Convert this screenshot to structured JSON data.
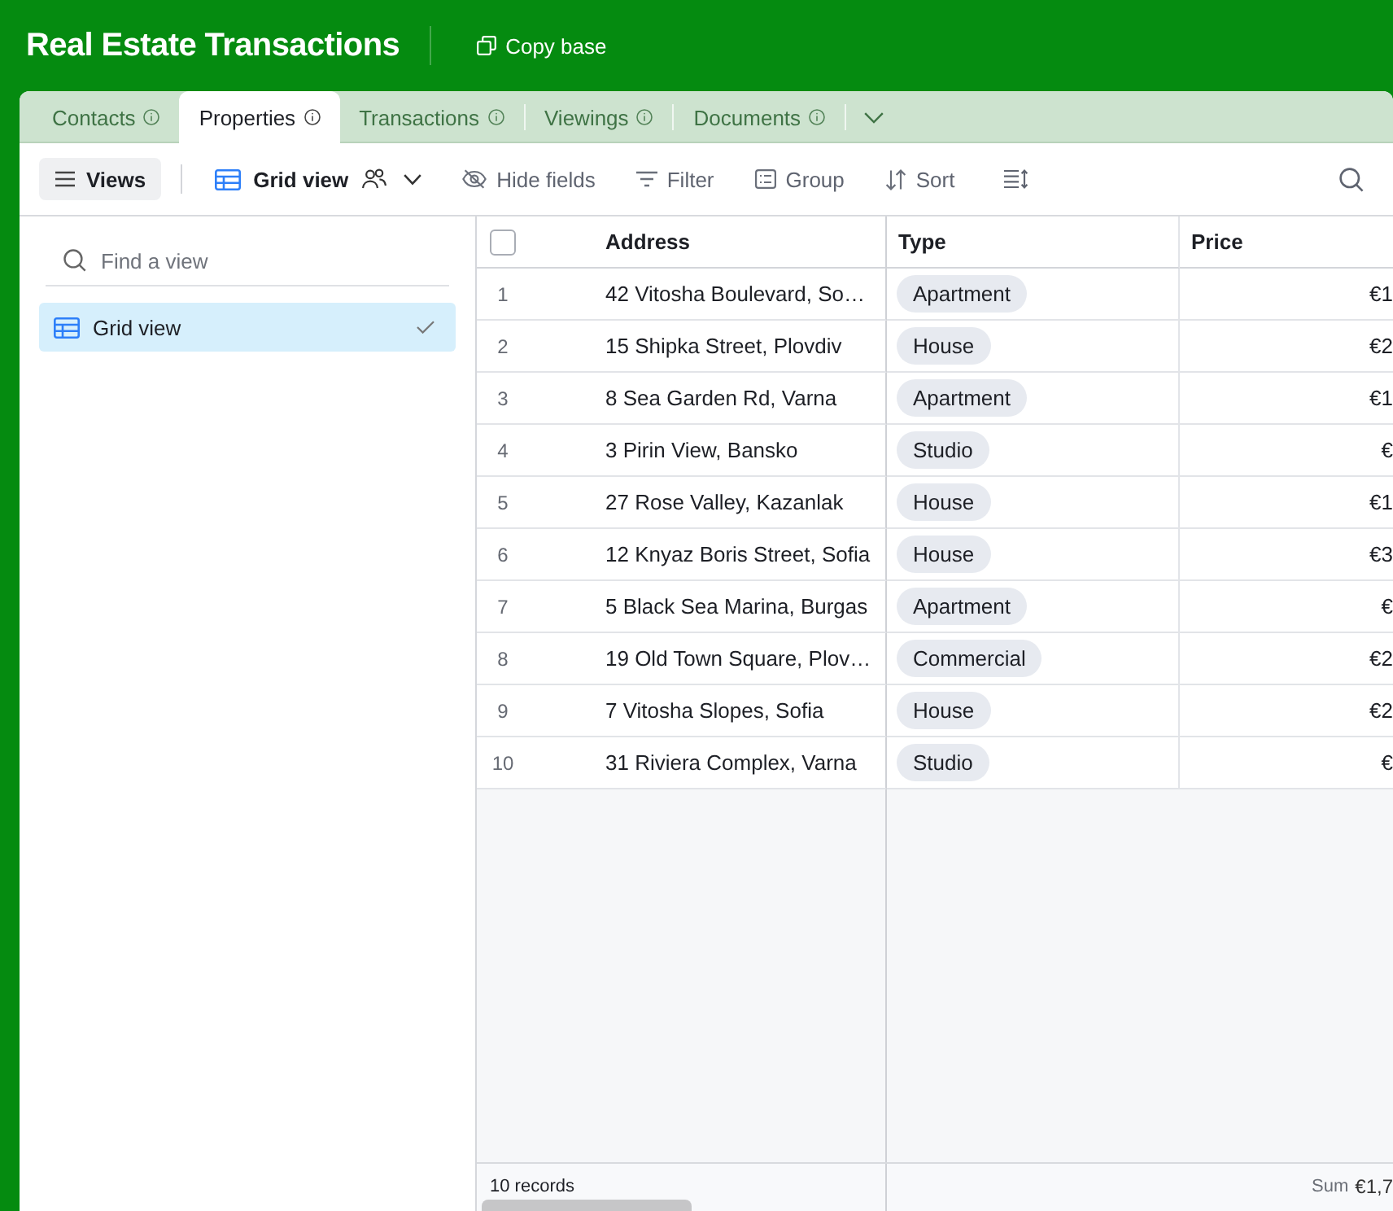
{
  "header": {
    "title": "Real Estate Transactions",
    "copy_button": "Copy base"
  },
  "tabs": [
    {
      "label": "Contacts",
      "selected": false
    },
    {
      "label": "Properties",
      "selected": true
    },
    {
      "label": "Transactions",
      "selected": false
    },
    {
      "label": "Viewings",
      "selected": false
    },
    {
      "label": "Documents",
      "selected": false
    }
  ],
  "toolbar": {
    "views_button": "Views",
    "view_name": "Grid view",
    "buttons": [
      {
        "kind": "hide",
        "label": "Hide fields"
      },
      {
        "kind": "filter",
        "label": "Filter"
      },
      {
        "kind": "group",
        "label": "Group"
      },
      {
        "kind": "sort",
        "label": "Sort"
      }
    ]
  },
  "sidebar": {
    "search": {
      "placeholder": "Find a view"
    },
    "views": [
      {
        "label": "Grid view",
        "selected": true
      }
    ]
  },
  "table": {
    "select_all": {
      "checked": false
    },
    "columns": [
      "Address",
      "Type",
      "Price"
    ],
    "rows": [
      {
        "number": "1",
        "address": "42 Vitosha Boulevard, So…",
        "type": "Apartment",
        "price": "€1"
      },
      {
        "number": "2",
        "address": "15 Shipka Street, Plovdiv",
        "type": "House",
        "price": "€2"
      },
      {
        "number": "3",
        "address": "8 Sea Garden Rd, Varna",
        "type": "Apartment",
        "price": "€1"
      },
      {
        "number": "4",
        "address": "3 Pirin View, Bansko",
        "type": "Studio",
        "price": "€"
      },
      {
        "number": "5",
        "address": "27 Rose Valley, Kazanlak",
        "type": "House",
        "price": "€1"
      },
      {
        "number": "6",
        "address": "12 Knyaz Boris Street, Sofia",
        "type": "House",
        "price": "€3"
      },
      {
        "number": "7",
        "address": "5 Black Sea Marina, Burgas",
        "type": "Apartment",
        "price": "€"
      },
      {
        "number": "8",
        "address": "19 Old Town Square, Plov…",
        "type": "Commercial",
        "price": "€2"
      },
      {
        "number": "9",
        "address": "7 Vitosha Slopes, Sofia",
        "type": "House",
        "price": "€2"
      },
      {
        "number": "10",
        "address": "31 Riviera Complex, Varna",
        "type": "Studio",
        "price": "€"
      }
    ],
    "footer": {
      "record_count": "10 records",
      "sum_label": "Sum",
      "sum_value": "€1,7"
    }
  }
}
